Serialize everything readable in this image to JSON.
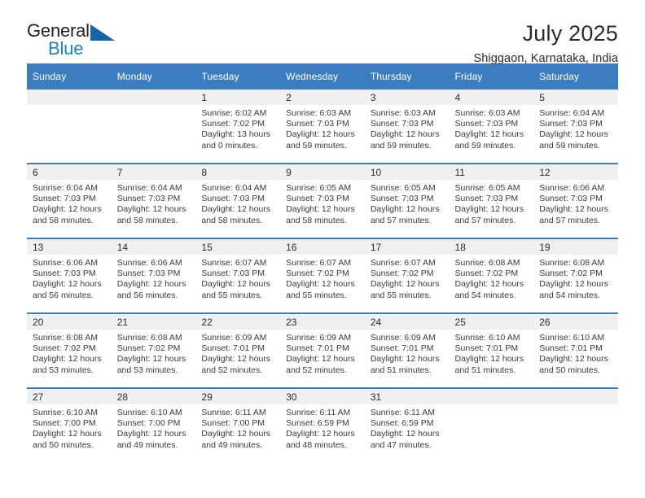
{
  "brand": {
    "name_part1": "General",
    "name_part2": "Blue"
  },
  "header": {
    "title": "July 2025",
    "location": "Shiggaon, Karnataka, India"
  },
  "calendar": {
    "weekday_headers": [
      "Sunday",
      "Monday",
      "Tuesday",
      "Wednesday",
      "Thursday",
      "Friday",
      "Saturday"
    ],
    "colors": {
      "header_bg": "#3b7dbf",
      "header_text": "#ffffff",
      "row_divider": "#3b7dbf",
      "day_number_band": "#f0f0f0",
      "brand_blue": "#1f7fc4",
      "brand_triangle": "#1565a8"
    },
    "weeks": [
      [
        {
          "day": "",
          "sunrise": "",
          "sunset": "",
          "daylight": ""
        },
        {
          "day": "",
          "sunrise": "",
          "sunset": "",
          "daylight": ""
        },
        {
          "day": "1",
          "sunrise": "Sunrise: 6:02 AM",
          "sunset": "Sunset: 7:02 PM",
          "daylight": "Daylight: 13 hours and 0 minutes."
        },
        {
          "day": "2",
          "sunrise": "Sunrise: 6:03 AM",
          "sunset": "Sunset: 7:03 PM",
          "daylight": "Daylight: 12 hours and 59 minutes."
        },
        {
          "day": "3",
          "sunrise": "Sunrise: 6:03 AM",
          "sunset": "Sunset: 7:03 PM",
          "daylight": "Daylight: 12 hours and 59 minutes."
        },
        {
          "day": "4",
          "sunrise": "Sunrise: 6:03 AM",
          "sunset": "Sunset: 7:03 PM",
          "daylight": "Daylight: 12 hours and 59 minutes."
        },
        {
          "day": "5",
          "sunrise": "Sunrise: 6:04 AM",
          "sunset": "Sunset: 7:03 PM",
          "daylight": "Daylight: 12 hours and 59 minutes."
        }
      ],
      [
        {
          "day": "6",
          "sunrise": "Sunrise: 6:04 AM",
          "sunset": "Sunset: 7:03 PM",
          "daylight": "Daylight: 12 hours and 58 minutes."
        },
        {
          "day": "7",
          "sunrise": "Sunrise: 6:04 AM",
          "sunset": "Sunset: 7:03 PM",
          "daylight": "Daylight: 12 hours and 58 minutes."
        },
        {
          "day": "8",
          "sunrise": "Sunrise: 6:04 AM",
          "sunset": "Sunset: 7:03 PM",
          "daylight": "Daylight: 12 hours and 58 minutes."
        },
        {
          "day": "9",
          "sunrise": "Sunrise: 6:05 AM",
          "sunset": "Sunset: 7:03 PM",
          "daylight": "Daylight: 12 hours and 58 minutes."
        },
        {
          "day": "10",
          "sunrise": "Sunrise: 6:05 AM",
          "sunset": "Sunset: 7:03 PM",
          "daylight": "Daylight: 12 hours and 57 minutes."
        },
        {
          "day": "11",
          "sunrise": "Sunrise: 6:05 AM",
          "sunset": "Sunset: 7:03 PM",
          "daylight": "Daylight: 12 hours and 57 minutes."
        },
        {
          "day": "12",
          "sunrise": "Sunrise: 6:06 AM",
          "sunset": "Sunset: 7:03 PM",
          "daylight": "Daylight: 12 hours and 57 minutes."
        }
      ],
      [
        {
          "day": "13",
          "sunrise": "Sunrise: 6:06 AM",
          "sunset": "Sunset: 7:03 PM",
          "daylight": "Daylight: 12 hours and 56 minutes."
        },
        {
          "day": "14",
          "sunrise": "Sunrise: 6:06 AM",
          "sunset": "Sunset: 7:03 PM",
          "daylight": "Daylight: 12 hours and 56 minutes."
        },
        {
          "day": "15",
          "sunrise": "Sunrise: 6:07 AM",
          "sunset": "Sunset: 7:03 PM",
          "daylight": "Daylight: 12 hours and 55 minutes."
        },
        {
          "day": "16",
          "sunrise": "Sunrise: 6:07 AM",
          "sunset": "Sunset: 7:02 PM",
          "daylight": "Daylight: 12 hours and 55 minutes."
        },
        {
          "day": "17",
          "sunrise": "Sunrise: 6:07 AM",
          "sunset": "Sunset: 7:02 PM",
          "daylight": "Daylight: 12 hours and 55 minutes."
        },
        {
          "day": "18",
          "sunrise": "Sunrise: 6:08 AM",
          "sunset": "Sunset: 7:02 PM",
          "daylight": "Daylight: 12 hours and 54 minutes."
        },
        {
          "day": "19",
          "sunrise": "Sunrise: 6:08 AM",
          "sunset": "Sunset: 7:02 PM",
          "daylight": "Daylight: 12 hours and 54 minutes."
        }
      ],
      [
        {
          "day": "20",
          "sunrise": "Sunrise: 6:08 AM",
          "sunset": "Sunset: 7:02 PM",
          "daylight": "Daylight: 12 hours and 53 minutes."
        },
        {
          "day": "21",
          "sunrise": "Sunrise: 6:08 AM",
          "sunset": "Sunset: 7:02 PM",
          "daylight": "Daylight: 12 hours and 53 minutes."
        },
        {
          "day": "22",
          "sunrise": "Sunrise: 6:09 AM",
          "sunset": "Sunset: 7:01 PM",
          "daylight": "Daylight: 12 hours and 52 minutes."
        },
        {
          "day": "23",
          "sunrise": "Sunrise: 6:09 AM",
          "sunset": "Sunset: 7:01 PM",
          "daylight": "Daylight: 12 hours and 52 minutes."
        },
        {
          "day": "24",
          "sunrise": "Sunrise: 6:09 AM",
          "sunset": "Sunset: 7:01 PM",
          "daylight": "Daylight: 12 hours and 51 minutes."
        },
        {
          "day": "25",
          "sunrise": "Sunrise: 6:10 AM",
          "sunset": "Sunset: 7:01 PM",
          "daylight": "Daylight: 12 hours and 51 minutes."
        },
        {
          "day": "26",
          "sunrise": "Sunrise: 6:10 AM",
          "sunset": "Sunset: 7:01 PM",
          "daylight": "Daylight: 12 hours and 50 minutes."
        }
      ],
      [
        {
          "day": "27",
          "sunrise": "Sunrise: 6:10 AM",
          "sunset": "Sunset: 7:00 PM",
          "daylight": "Daylight: 12 hours and 50 minutes."
        },
        {
          "day": "28",
          "sunrise": "Sunrise: 6:10 AM",
          "sunset": "Sunset: 7:00 PM",
          "daylight": "Daylight: 12 hours and 49 minutes."
        },
        {
          "day": "29",
          "sunrise": "Sunrise: 6:11 AM",
          "sunset": "Sunset: 7:00 PM",
          "daylight": "Daylight: 12 hours and 49 minutes."
        },
        {
          "day": "30",
          "sunrise": "Sunrise: 6:11 AM",
          "sunset": "Sunset: 6:59 PM",
          "daylight": "Daylight: 12 hours and 48 minutes."
        },
        {
          "day": "31",
          "sunrise": "Sunrise: 6:11 AM",
          "sunset": "Sunset: 6:59 PM",
          "daylight": "Daylight: 12 hours and 47 minutes."
        },
        {
          "day": "",
          "sunrise": "",
          "sunset": "",
          "daylight": ""
        },
        {
          "day": "",
          "sunrise": "",
          "sunset": "",
          "daylight": ""
        }
      ]
    ]
  }
}
